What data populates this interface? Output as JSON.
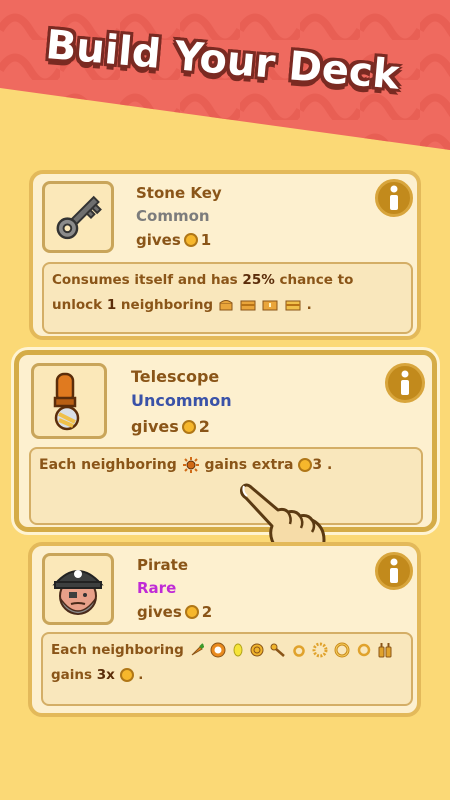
{
  "header": {
    "title": "Build Your Deck",
    "colors": {
      "banner": "#ef6a5f",
      "banner_dark": "#e4574c",
      "outline": "#7a2a22"
    }
  },
  "cards": [
    {
      "name": "Stone Key",
      "rarity": "Common",
      "rarity_color": "#7c7c7c",
      "gives_label": "gives",
      "gives_value": "1",
      "icon": "stone-key-icon",
      "desc": {
        "part1": "Consumes itself and has",
        "chance": "25%",
        "part2": "chance to unlock",
        "count": "1",
        "part3": "neighboring",
        "end": "."
      }
    },
    {
      "name": "Telescope",
      "rarity": "Uncommon",
      "rarity_color": "#3a52a8",
      "gives_label": "gives",
      "gives_value": "2",
      "icon": "telescope-icon",
      "desc": {
        "part1": "Each neighboring",
        "part2": "gains extra",
        "value": "3",
        "end": "."
      }
    },
    {
      "name": "Pirate",
      "rarity": "Rare",
      "rarity_color": "#c02ad6",
      "gives_label": "gives",
      "gives_value": "2",
      "icon": "pirate-icon",
      "desc": {
        "part1": "Each neighboring",
        "part2": "gains",
        "mult": "3x",
        "end": "."
      }
    }
  ]
}
